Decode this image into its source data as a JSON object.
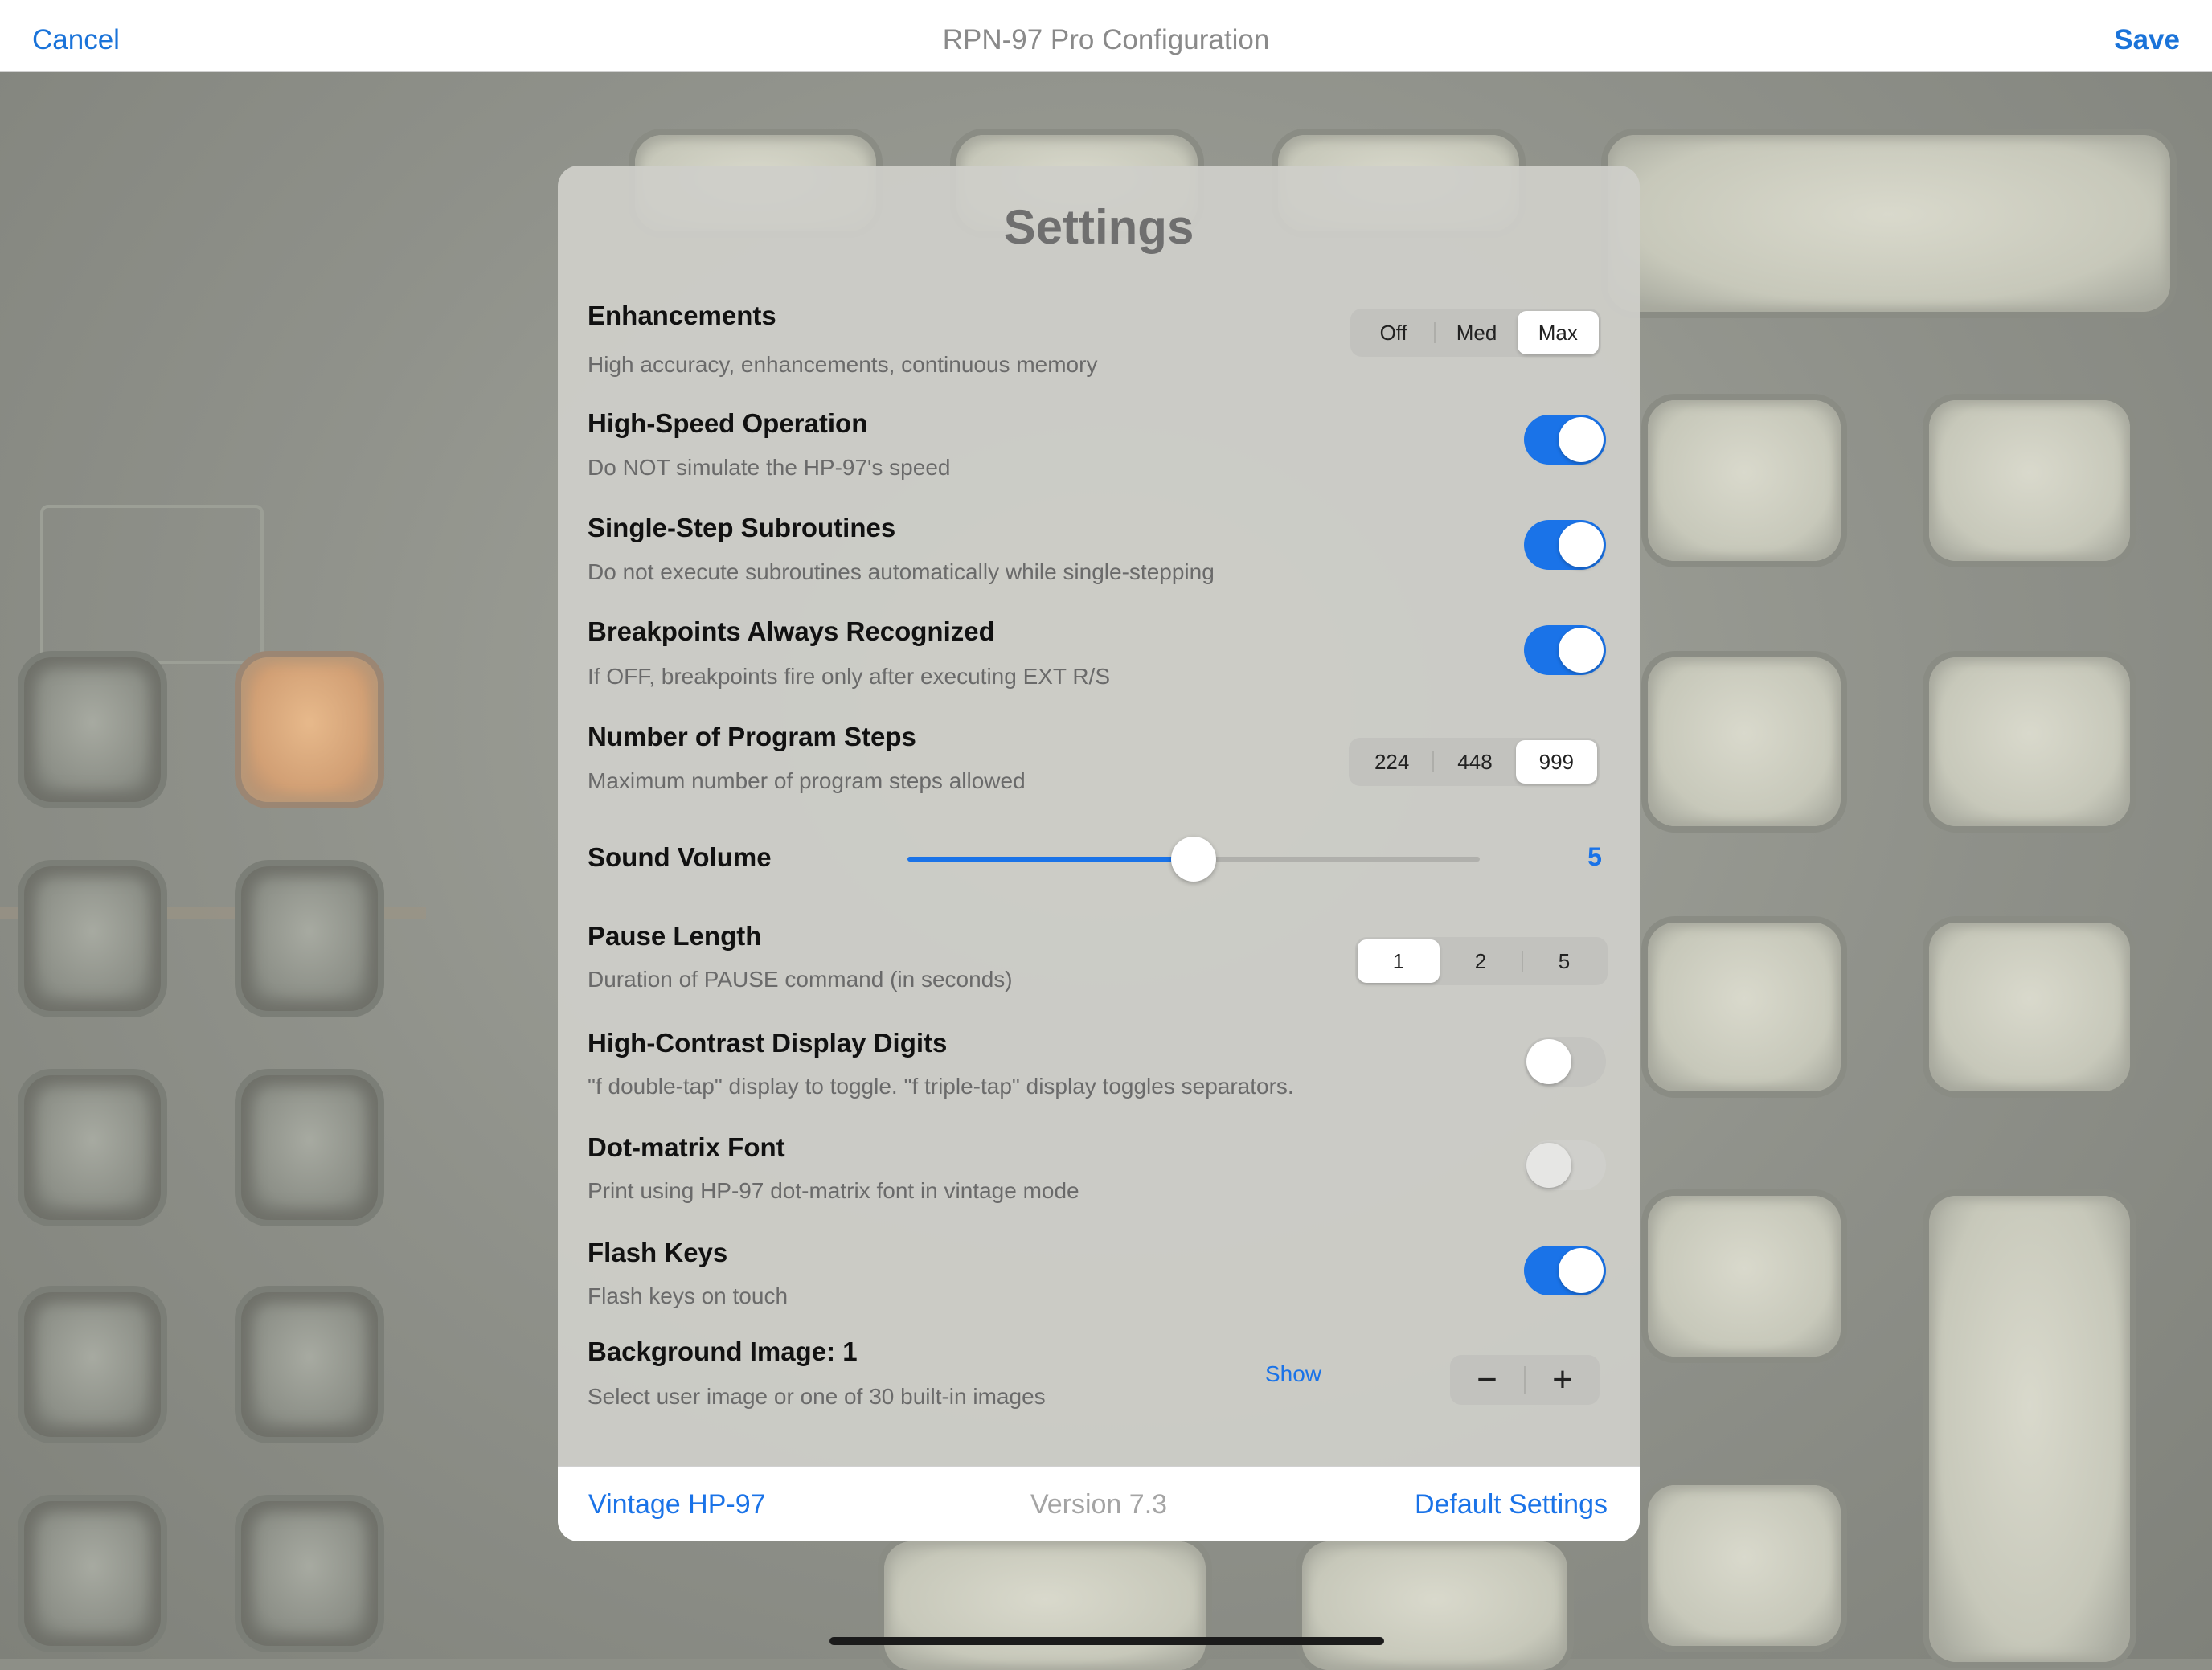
{
  "nav": {
    "cancel": "Cancel",
    "title": "RPN-97 Pro Configuration",
    "save": "Save"
  },
  "panel": {
    "title": "Settings"
  },
  "enhancements": {
    "title": "Enhancements",
    "subtitle": "High accuracy, enhancements, continuous memory",
    "options": [
      "Off",
      "Med",
      "Max"
    ],
    "selected": "Max"
  },
  "high_speed": {
    "title": "High-Speed Operation",
    "subtitle": "Do NOT simulate the HP-97's speed",
    "on": true
  },
  "single_step": {
    "title": "Single-Step Subroutines",
    "subtitle": "Do not execute subroutines automatically while single-stepping",
    "on": true
  },
  "breakpoints": {
    "title": "Breakpoints Always Recognized",
    "subtitle": "If OFF, breakpoints fire only after executing EXT R/S",
    "on": true
  },
  "program_steps": {
    "title": "Number of Program Steps",
    "subtitle": "Maximum number of program steps allowed",
    "options": [
      "224",
      "448",
      "999"
    ],
    "selected": "999"
  },
  "sound_volume": {
    "title": "Sound Volume",
    "value": "5",
    "fraction": 0.5
  },
  "pause_length": {
    "title": "Pause Length",
    "subtitle": "Duration of PAUSE command (in seconds)",
    "options": [
      "1",
      "2",
      "5"
    ],
    "selected": "1"
  },
  "high_contrast": {
    "title": "High-Contrast Display Digits",
    "subtitle": "\"f double-tap\" display to toggle. \"f triple-tap\" display toggles separators.",
    "on": false
  },
  "dot_matrix": {
    "title": "Dot-matrix Font",
    "subtitle": "Print using HP-97 dot-matrix font in vintage mode",
    "on": false,
    "disabled": true
  },
  "flash_keys": {
    "title": "Flash Keys",
    "subtitle": "Flash keys on touch",
    "on": true
  },
  "background_image": {
    "title": "Background Image: 1",
    "subtitle": "Select user image or one of 30 built-in images",
    "show": "Show",
    "minus": "−",
    "plus": "+"
  },
  "footer": {
    "vintage": "Vintage HP-97",
    "version": "Version 7.3",
    "defaults": "Default Settings"
  },
  "colors": {
    "accent": "#1a73e8",
    "nav_link": "#1a73d9"
  }
}
